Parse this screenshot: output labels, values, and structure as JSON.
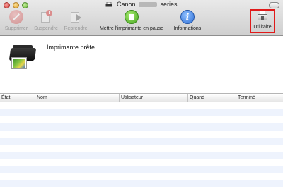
{
  "window": {
    "title_prefix": "Canon",
    "title_suffix": "series"
  },
  "toolbar": {
    "delete_label": "Supprimer",
    "suspend_label": "Suspendre",
    "resume_label": "Reprendre",
    "pause_printer_label": "Mettre l'imprimante en pause",
    "info_label": "Informations",
    "utility_label": "Utilitaire"
  },
  "status": {
    "text": "Imprimante prête"
  },
  "jobs_table": {
    "columns": [
      "État",
      "Nom",
      "Utilisateur",
      "Quand",
      "Terminé"
    ],
    "rows": []
  },
  "colors": {
    "highlight": "#e01a1a",
    "row_alt": "#eef3fd"
  }
}
